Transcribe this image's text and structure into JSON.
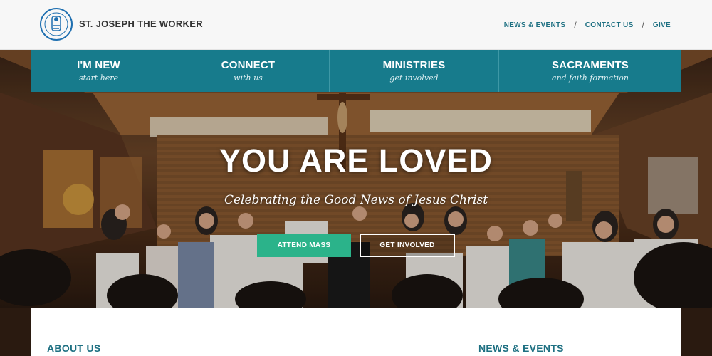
{
  "header": {
    "brand": "ST. JOSEPH THE WORKER",
    "nav": [
      {
        "label": "NEWS & EVENTS"
      },
      {
        "label": "CONTACT US"
      },
      {
        "label": "GIVE"
      }
    ],
    "separator": "/"
  },
  "main_nav": [
    {
      "label": "I'M NEW",
      "sub": "start here"
    },
    {
      "label": "CONNECT",
      "sub": "with us"
    },
    {
      "label": "MINISTRIES",
      "sub": "get involved"
    },
    {
      "label": "SACRAMENTS",
      "sub": "and faith formation"
    }
  ],
  "hero": {
    "headline": "YOU ARE LOVED",
    "tagline": "Celebrating the Good News of Jesus Christ",
    "primary_button": "ATTEND MASS",
    "secondary_button": "GET INVOLVED"
  },
  "sections": {
    "about": "ABOUT US",
    "news": "NEWS & EVENTS"
  },
  "colors": {
    "accent": "#177b8c",
    "link": "#1e7082",
    "button_green": "#2bb38a"
  }
}
